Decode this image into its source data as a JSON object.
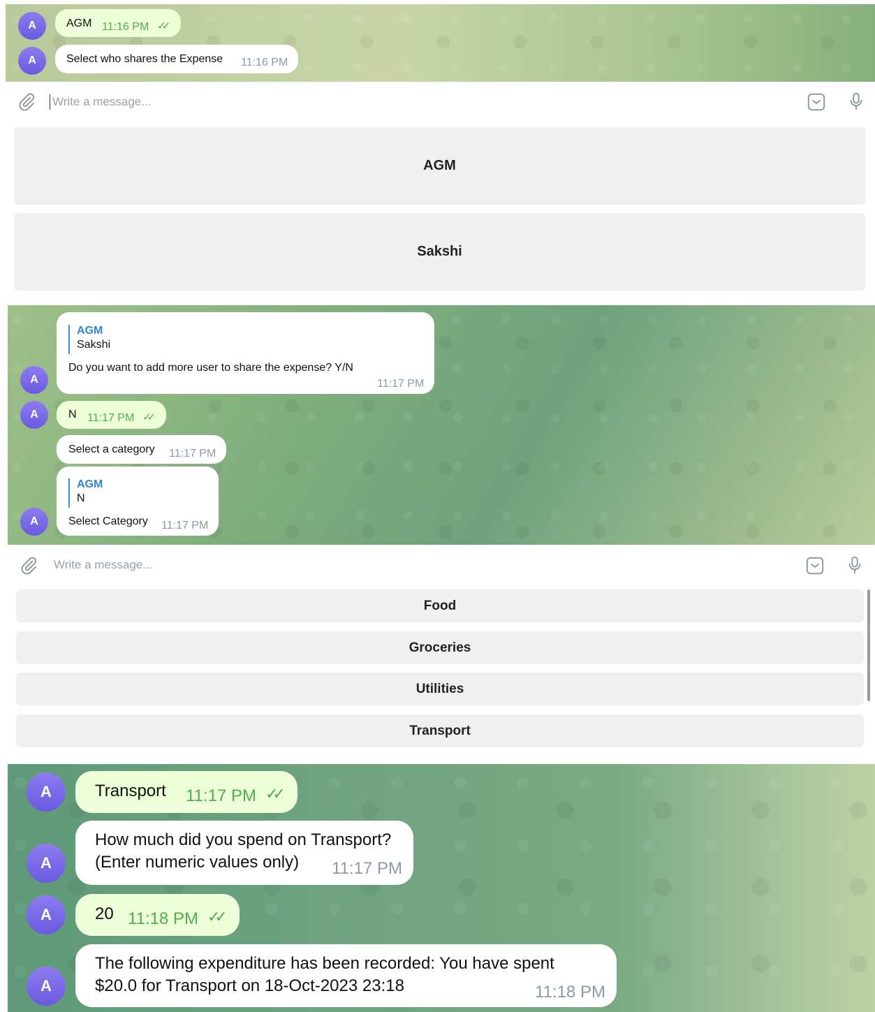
{
  "panel1": {
    "messages": [
      {
        "avatar": "A",
        "text": "AGM",
        "time": "11:16 PM",
        "ticks": "✓✓",
        "outgoing": true
      },
      {
        "avatar": "A",
        "text": "Select who shares the Expense",
        "time": "11:16 PM",
        "outgoing": false
      }
    ],
    "input": {
      "placeholder": "Write a message...",
      "attach_icon": "paperclip-icon",
      "sticker_icon": "sticker-icon",
      "mic_icon": "microphone-icon"
    },
    "keyboard": [
      "AGM",
      "Sakshi"
    ]
  },
  "panel2": {
    "messages": [
      {
        "avatar": "A",
        "quote_name": "AGM",
        "quote_text": "Sakshi",
        "text": "Do you want to add more user to share the expense? Y/N",
        "time": "11:17 PM"
      },
      {
        "avatar": "A",
        "text": "N",
        "time": "11:17 PM",
        "ticks": "✓✓"
      },
      {
        "text": "Select a category",
        "time": "11:17 PM"
      },
      {
        "avatar": "A",
        "quote_name": "AGM",
        "quote_text": "N",
        "text": "Select Category",
        "time": "11:17 PM"
      }
    ],
    "input": {
      "placeholder": "Write a message..."
    },
    "keyboard": [
      "Food",
      "Groceries",
      "Utilities",
      "Transport"
    ]
  },
  "panel3": {
    "messages": [
      {
        "avatar": "A",
        "text": "Transport",
        "time": "11:17 PM",
        "ticks": "✓✓"
      },
      {
        "avatar": "A",
        "line1": "How much did you spend on Transport?",
        "line2": "(Enter numeric values only)",
        "time": "11:17 PM"
      },
      {
        "avatar": "A",
        "text": "20",
        "time": "11:18 PM",
        "ticks": "✓✓"
      },
      {
        "avatar": "A",
        "line1": "The following expenditure has been recorded: You have spent",
        "line2": "$20.0 for Transport on 18-Oct-2023 23:18",
        "time": "11:18 PM"
      }
    ]
  },
  "colors": {
    "outgoing_bubble": "#eefed9",
    "incoming_bubble": "#ffffff",
    "accent_blue": "#2f86d6",
    "check_green": "#4fae4e",
    "avatar": "#7b6be8"
  }
}
